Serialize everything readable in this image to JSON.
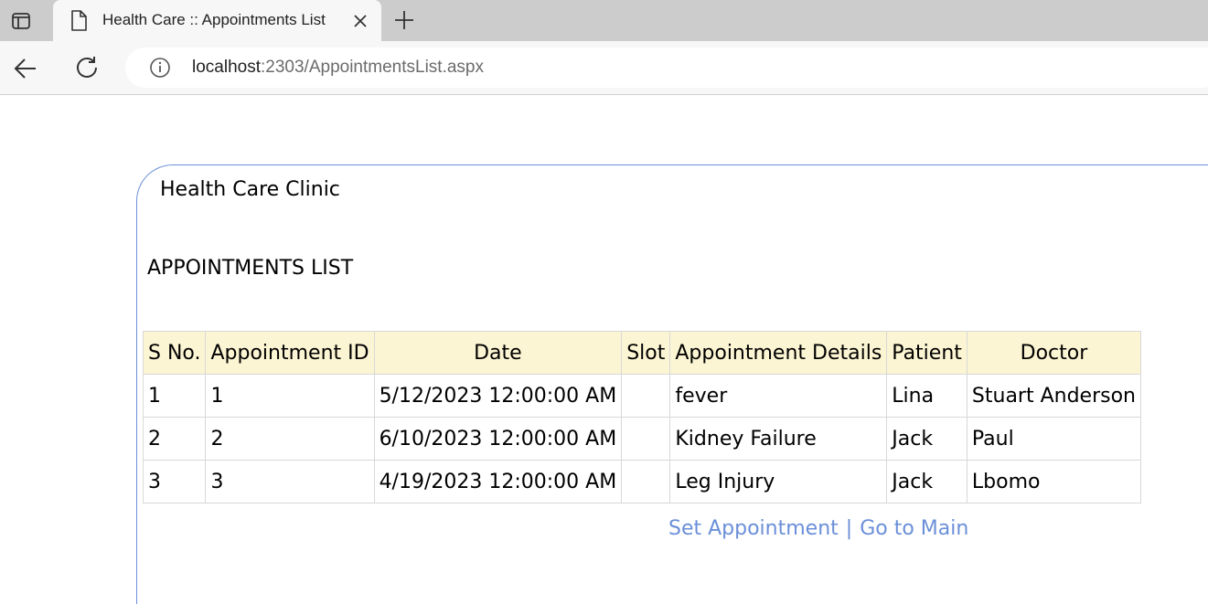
{
  "browser": {
    "tab_title": "Health Care :: Appointments List",
    "url_host": "localhost",
    "url_path": ":2303/AppointmentsList.aspx"
  },
  "page": {
    "clinic_title": "Health Care Clinic",
    "list_title": "APPOINTMENTS LIST",
    "table": {
      "headers": [
        "S No.",
        "Appointment ID",
        "Date",
        "Slot",
        "Appointment Details",
        "Patient",
        "Doctor"
      ],
      "rows": [
        [
          "1",
          "1",
          "5/12/2023 12:00:00 AM",
          "",
          "fever",
          "Lina",
          "Stuart Anderson"
        ],
        [
          "2",
          "2",
          "6/10/2023 12:00:00 AM",
          "",
          "Kidney Failure",
          "Jack",
          "Paul"
        ],
        [
          "3",
          "3",
          "4/19/2023 12:00:00 AM",
          "",
          "Leg Injury",
          "Jack",
          "Lbomo"
        ]
      ]
    },
    "links": {
      "set_appointment": "Set Appointment",
      "separator": "|",
      "go_to_main": "Go to Main"
    }
  },
  "colors": {
    "header_bg": "#fcf5d3",
    "link": "#6b8fd8",
    "panel_border": "#6b8fd8",
    "tabstrip_bg": "#cccccc"
  }
}
